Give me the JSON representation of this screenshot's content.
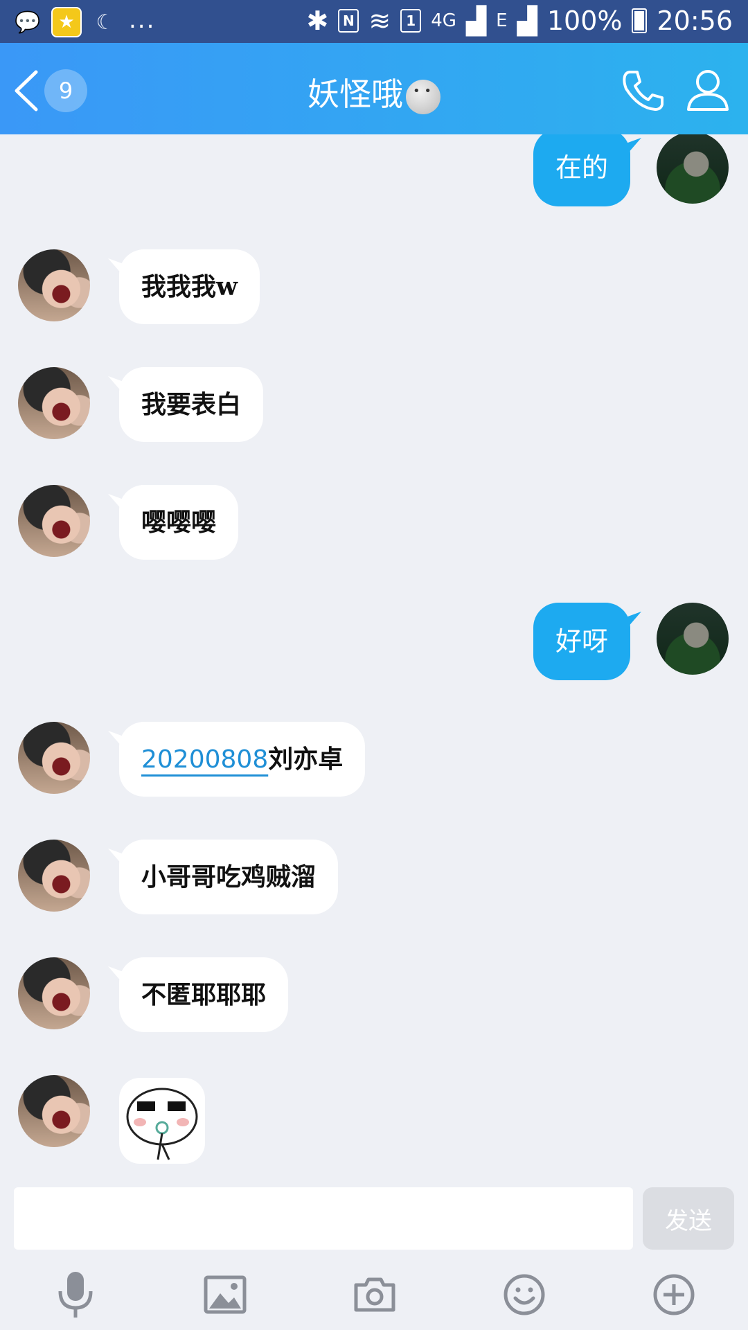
{
  "status_bar": {
    "time": "20:56",
    "battery": "100%",
    "network": "4G",
    "signal_e": "E",
    "sim_badge": "1",
    "more": "..."
  },
  "header": {
    "unread_count": "9",
    "title": "妖怪哦"
  },
  "messages": [
    {
      "side": "me",
      "text": "在的"
    },
    {
      "side": "friend",
      "text": "我我我w"
    },
    {
      "side": "friend",
      "text": "我要表白"
    },
    {
      "side": "friend",
      "text": "嘤嘤嘤"
    },
    {
      "side": "me",
      "text": "好呀"
    },
    {
      "side": "friend",
      "link": "20200808",
      "text": "刘亦卓"
    },
    {
      "side": "friend",
      "text": "小哥哥吃鸡贼溜"
    },
    {
      "side": "friend",
      "text": "不匿耶耶耶"
    },
    {
      "side": "friend",
      "type": "sticker"
    }
  ],
  "input": {
    "value": "",
    "send_label": "发送"
  },
  "toolbar": [
    "microphone-icon",
    "image-icon",
    "camera-icon",
    "emoji-icon",
    "plus-icon"
  ],
  "colors": {
    "header_start": "#3a98f7",
    "header_end": "#2cb2ee",
    "my_bubble": "#1daaf0",
    "link": "#1f8fd6"
  }
}
